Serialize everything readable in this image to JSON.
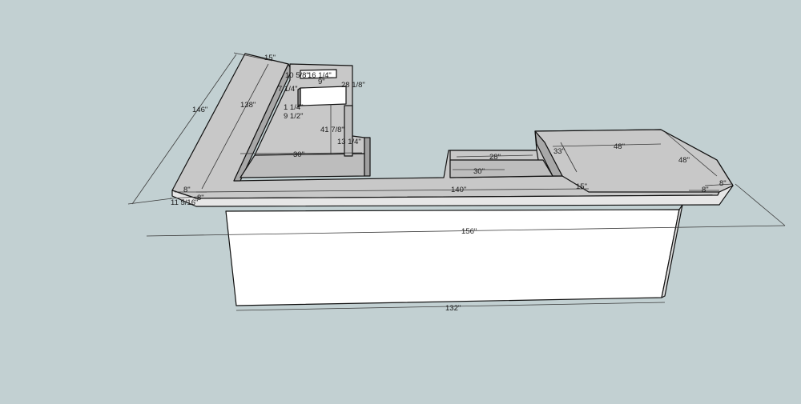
{
  "colors": {
    "background": "#c2d0d2",
    "top_surface": "#c8c8c8",
    "front_face": "#ffffff",
    "side_face": "#dcdcdc",
    "edge": "#111111",
    "dimension": "#333333"
  },
  "dimensions": {
    "d146": "146\"",
    "d15_top": "15\"",
    "d138": "138\"",
    "d10_5": "10 5/8\"",
    "d16_1_4": "16 1/4\"",
    "d9": "9\"",
    "d7_1_4": "7 1/4\"",
    "d28_1_8": "28 1/8\"",
    "d1_1_4": "1 1/4\"",
    "d9_1_2": "9 1/2\"",
    "d41_7_8": "41 7/8\"",
    "d13": "13 1/4\"",
    "d30_left": "30\"",
    "d28": "28\"",
    "d30_right": "30\"",
    "d33": "33\"",
    "d48_top": "48\"",
    "d48_side": "48\"",
    "d8_left": "8\"",
    "d8_left_low": "8\"",
    "d11_5_16": "11 5/16\"",
    "d140": "140\"",
    "d15_right": "15\"",
    "d8_right": "8\"",
    "d8_right_end": "8\"",
    "d156": "156\"",
    "d132": "132\""
  }
}
